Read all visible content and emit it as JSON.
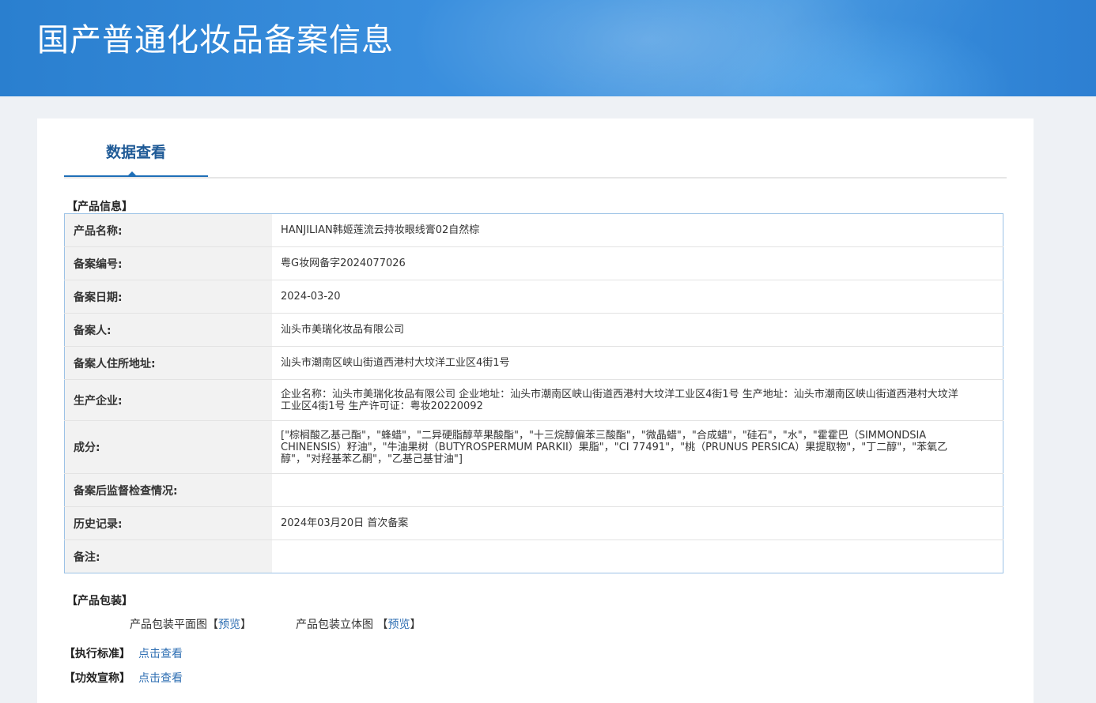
{
  "header": {
    "title": "国产普通化妆品备案信息"
  },
  "tabs": [
    {
      "label": "数据查看"
    }
  ],
  "product_info": {
    "section_title": "【产品信息】",
    "rows": [
      {
        "label": "产品名称:",
        "value": "HANJILIAN韩姬莲流云持妆眼线膏02自然棕"
      },
      {
        "label": "备案编号:",
        "value": "粤G妆网备字2024077026"
      },
      {
        "label": "备案日期:",
        "value": "2024-03-20"
      },
      {
        "label": "备案人:",
        "value": "汕头市美瑞化妆品有限公司"
      },
      {
        "label": "备案人住所地址:",
        "value": "汕头市潮南区峡山街道西港村大坟洋工业区4街1号"
      },
      {
        "label": "生产企业:",
        "value": "企业名称：汕头市美瑞化妆品有限公司 企业地址：汕头市潮南区峡山街道西港村大坟洋工业区4街1号 生产地址：汕头市潮南区峡山街道西港村大坟洋工业区4街1号 生产许可证：粤妆20220092"
      },
      {
        "label": "成分:",
        "value": "[\"棕榈酸乙基己酯\"，\"蜂蜡\"，\"二异硬脂醇苹果酸酯\"，\"十三烷醇偏苯三酸酯\"，\"微晶蜡\"，\"合成蜡\"，\"硅石\"，\"水\"，\"霍霍巴（SIMMONDSIA CHINENSIS）籽油\"，\"牛油果树（BUTYROSPERMUM PARKII）果脂\"，\"CI 77491\"，\"桃（PRUNUS PERSICA）果提取物\"，\"丁二醇\"，\"苯氧乙醇\"，\"对羟基苯乙酮\"，\"乙基己基甘油\"]"
      },
      {
        "label": "备案后监督检查情况:",
        "value": ""
      },
      {
        "label": "历史记录:",
        "value": "2024年03月20日 首次备案"
      },
      {
        "label": "备注:",
        "value": ""
      }
    ]
  },
  "packaging": {
    "section_title": "【产品包装】",
    "flat_label": "产品包装平面图",
    "flat_link": "预览",
    "solid_label": "产品包装立体图",
    "solid_link": "预览",
    "bracket_open": "【",
    "bracket_close": "】"
  },
  "standard": {
    "label": "【执行标准】",
    "link": "点击查看"
  },
  "efficacy": {
    "label": "【功效宣称】",
    "link": "点击查看"
  }
}
